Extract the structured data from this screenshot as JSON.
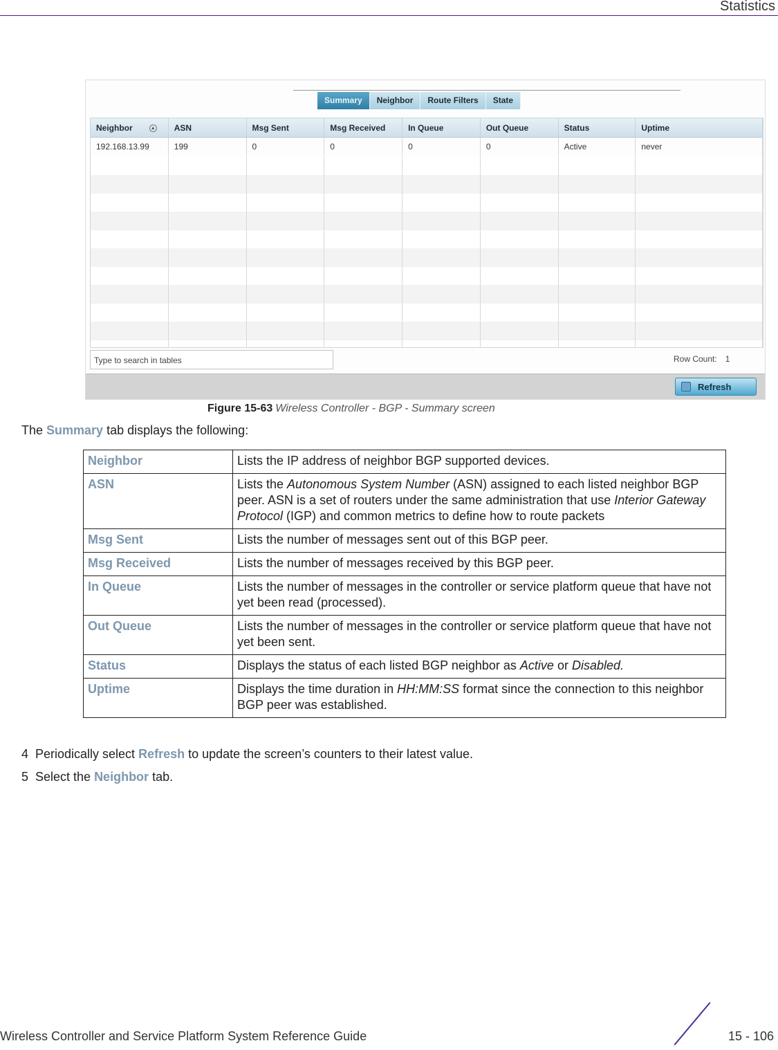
{
  "header": {
    "title": "Statistics"
  },
  "figure": {
    "tabs": [
      {
        "label": "Summary",
        "active": true
      },
      {
        "label": "Neighbor",
        "active": false
      },
      {
        "label": "Route Filters",
        "active": false
      },
      {
        "label": "State",
        "active": false
      }
    ],
    "columns": [
      "Neighbor",
      "ASN",
      "Msg Sent",
      "Msg Received",
      "In Queue",
      "Out Queue",
      "Status",
      "Uptime"
    ],
    "rows": [
      [
        "192.168.13.99",
        "199",
        "0",
        "0",
        "0",
        "0",
        "Active",
        "never"
      ]
    ],
    "search_placeholder": "Type to search in tables",
    "row_count_label": "Row Count:",
    "row_count_value": "1",
    "refresh_label": "Refresh"
  },
  "caption": {
    "number": "Figure 15-63",
    "text": "Wireless Controller - BGP - Summary screen"
  },
  "intro": {
    "pre": "The ",
    "highlight": "Summary",
    "post": " tab displays the following:"
  },
  "descriptions": [
    {
      "term": "Neighbor",
      "def": "Lists the IP address of neighbor BGP supported devices."
    },
    {
      "term": "ASN",
      "def_parts": [
        "Lists the ",
        "Autonomous System Number",
        " (ASN) assigned to each listed neighbor BGP peer. ASN is a set of routers under the same administration that use ",
        "Interior Gateway Protocol",
        " (IGP) and common metrics to define how to route packets"
      ]
    },
    {
      "term": "Msg Sent",
      "def": "Lists the number of messages sent out of this BGP peer."
    },
    {
      "term": "Msg Received",
      "def": "Lists the number of messages received by this BGP peer."
    },
    {
      "term": "In Queue",
      "def": "Lists the number of messages in the controller or service platform queue that have not yet been read (processed)."
    },
    {
      "term": "Out Queue",
      "def": "Lists the number of messages in the controller or service platform queue that have not yet been sent."
    },
    {
      "term": "Status",
      "def_parts": [
        "Displays the status of each listed BGP neighbor as ",
        "Active",
        " or ",
        "Disabled."
      ]
    },
    {
      "term": "Uptime",
      "def_parts": [
        "Displays the time duration in ",
        "HH:MM:SS",
        " format since the connection to this neighbor BGP peer was established."
      ]
    }
  ],
  "steps": [
    {
      "num": "4",
      "pre": "Periodically select ",
      "highlight": "Refresh",
      "post": " to update the screen’s counters to their latest value."
    },
    {
      "num": "5",
      "pre": "Select the ",
      "highlight": "Neighbor",
      "post": " tab."
    }
  ],
  "footer": {
    "guide_title": "Wireless Controller and Service Platform System Reference Guide",
    "page": "15 - 106"
  }
}
